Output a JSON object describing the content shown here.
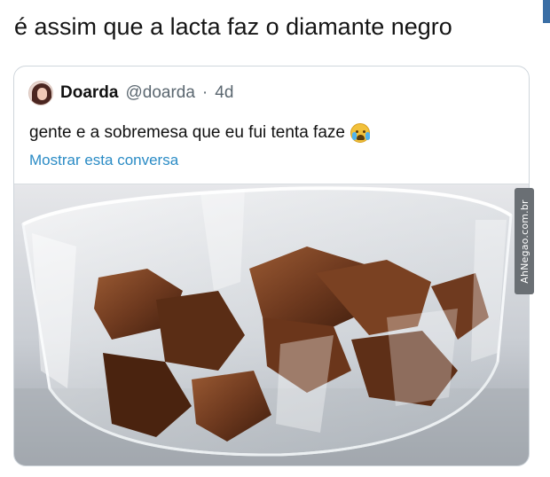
{
  "post": {
    "caption": "é assim que a lacta faz o diamante negro"
  },
  "quoted_tweet": {
    "display_name": "Doarda",
    "handle": "@doarda",
    "separator": "·",
    "time": "4d",
    "text": "gente e a sobremesa que eu fui tenta faze",
    "text_emoji": "loudly-crying-face-icon",
    "show_thread_label": "Mostrar esta conversa",
    "link_color": "#2a8bc5"
  },
  "watermark": {
    "text": "AhNegao.com.br"
  }
}
